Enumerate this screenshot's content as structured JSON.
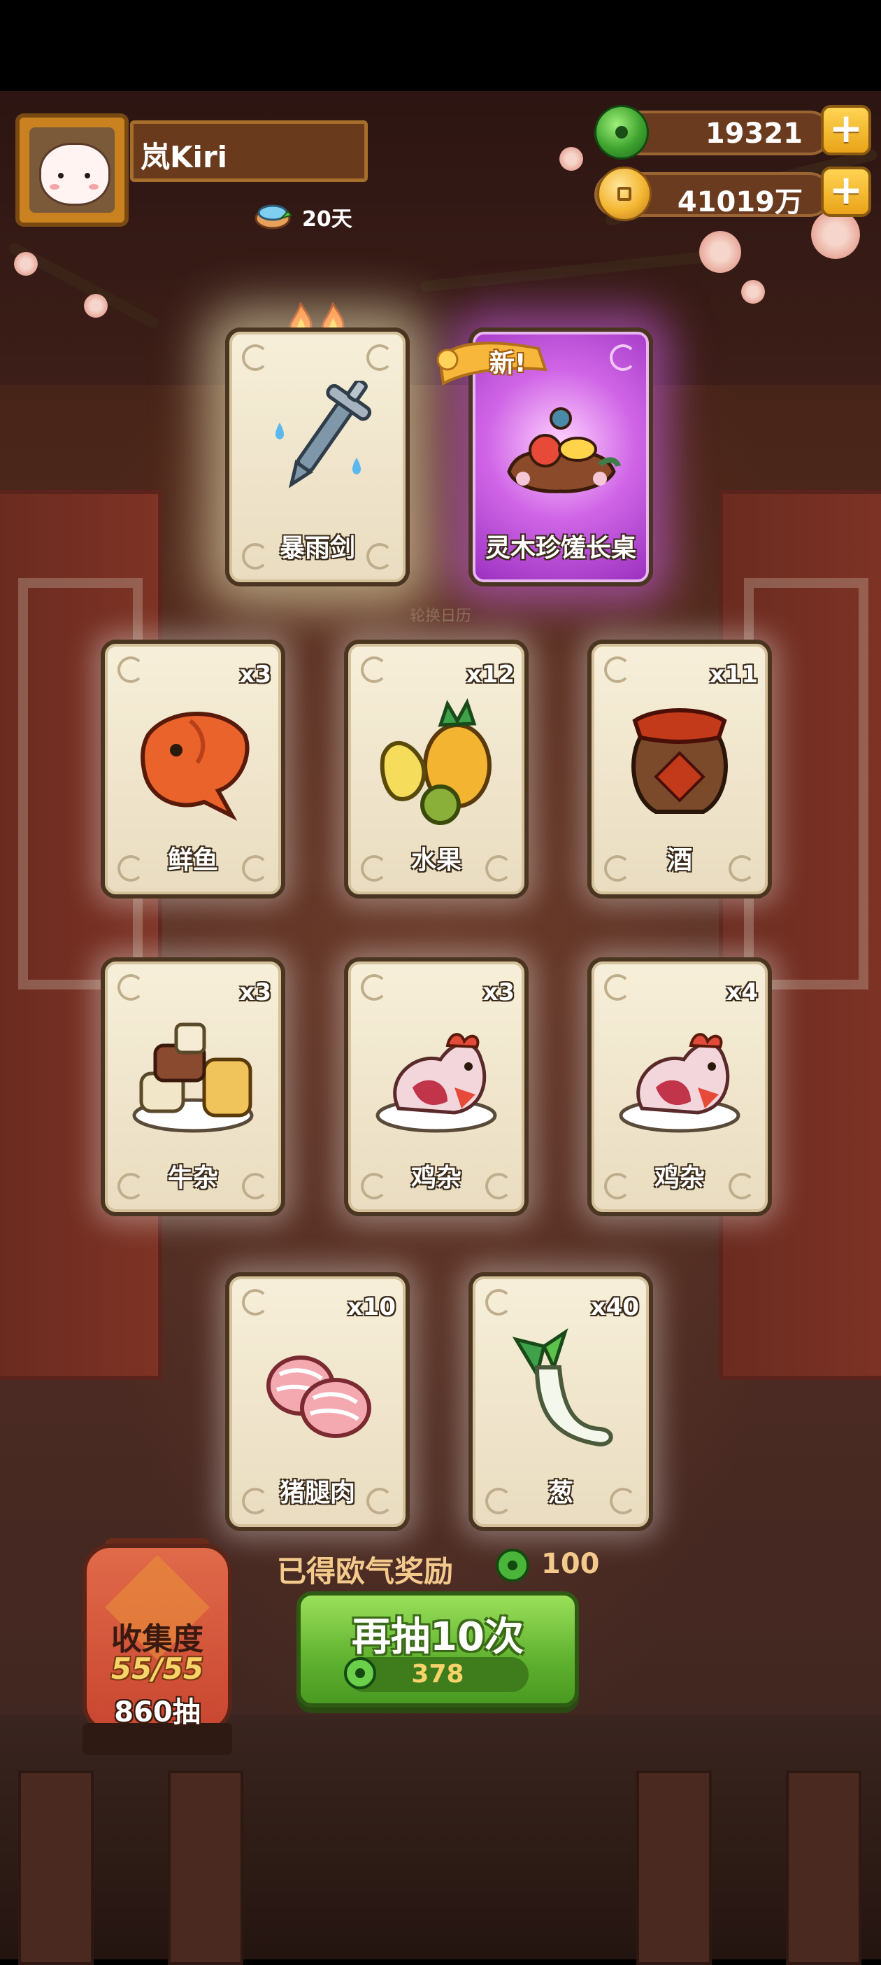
{
  "profile": {
    "name": "岚Kiri",
    "days": "20天"
  },
  "currency": {
    "jade": "19321",
    "coins": "41019万",
    "plus": "+"
  },
  "featured_cards": [
    {
      "label": "暴雨剑",
      "icon": "sword-icon",
      "rarity": "gold"
    },
    {
      "label": "灵木珍馐长桌",
      "icon": "banquet-table-icon",
      "rarity": "purple",
      "badge": "新!"
    }
  ],
  "calendar_label": "轮换日历",
  "cards": [
    {
      "label": "鲜鱼",
      "count": "x3",
      "icon": "fish-icon"
    },
    {
      "label": "水果",
      "count": "x12",
      "icon": "fruit-icon"
    },
    {
      "label": "酒",
      "count": "x11",
      "icon": "wine-jar-icon"
    },
    {
      "label": "牛杂",
      "count": "x3",
      "icon": "beef-offal-icon"
    },
    {
      "label": "鸡杂",
      "count": "x3",
      "icon": "chicken-offal-icon"
    },
    {
      "label": "鸡杂",
      "count": "x4",
      "icon": "chicken-offal-icon"
    },
    {
      "label": "猪腿肉",
      "count": "x10",
      "icon": "pork-icon"
    },
    {
      "label": "葱",
      "count": "x40",
      "icon": "scallion-icon"
    }
  ],
  "reward": {
    "text": "已得欧气奖励",
    "value": "100"
  },
  "collection": {
    "title": "收集度",
    "progress": "55/55",
    "draws": "860抽"
  },
  "draw_button": {
    "label": "再抽10次",
    "cost": "378"
  }
}
